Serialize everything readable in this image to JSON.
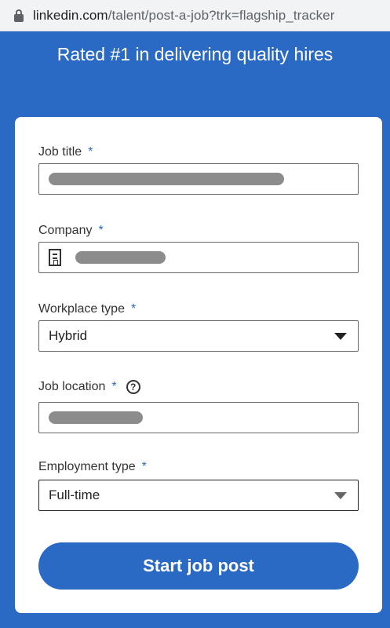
{
  "browser": {
    "url_domain": "linkedin.com",
    "url_path": "/talent/post-a-job?trk=flagship_tracker"
  },
  "headline": "Rated #1 in delivering quality hires",
  "form": {
    "required_marker": "*",
    "job_title": {
      "label": "Job title"
    },
    "company": {
      "label": "Company"
    },
    "workplace_type": {
      "label": "Workplace type",
      "value": "Hybrid"
    },
    "job_location": {
      "label": "Job location",
      "help_glyph": "?"
    },
    "employment_type": {
      "label": "Employment type",
      "value": "Full-time"
    },
    "submit_label": "Start job post"
  },
  "colors": {
    "brand_blue": "#2a6ac4",
    "card_bg": "#ffffff"
  },
  "icons": [
    "lock-icon",
    "building-icon",
    "help-icon",
    "chevron-down-icon"
  ]
}
